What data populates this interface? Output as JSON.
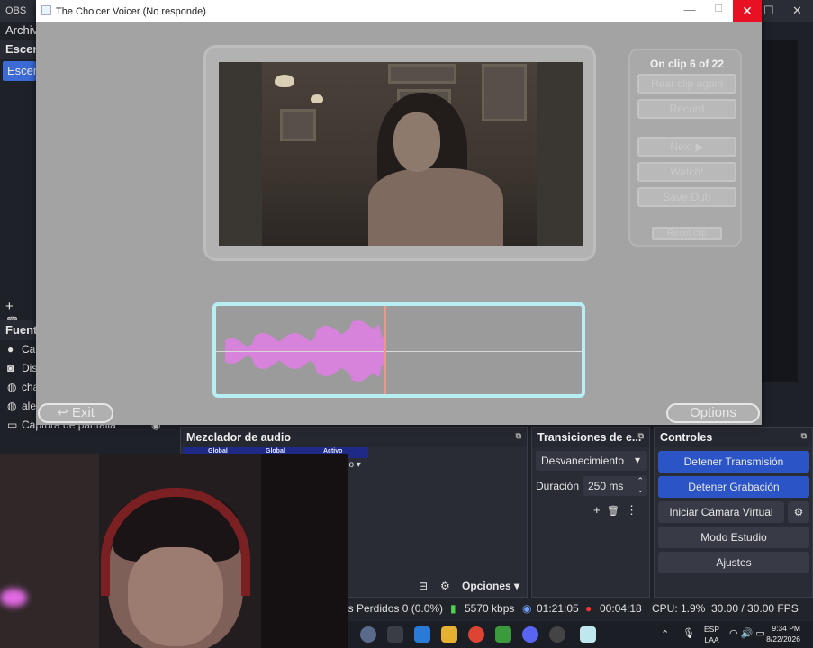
{
  "obs": {
    "title": "OBS",
    "menu": "Archiv",
    "scenes_header": "Escena",
    "scene_item": "Escen",
    "sources_header": "Fuent",
    "sources": [
      "Cap",
      "Dis",
      "cha",
      "ale",
      "Captura de pantalla"
    ],
    "mixer_title": "Mezclador de audio",
    "mixer_strip": [
      "Global",
      "Global",
      "Activo"
    ],
    "mixer_dropdown": "lio",
    "mixer_options": "Opciones",
    "transitions_title": "Transiciones de e...",
    "transition_value": "Desvanecimiento",
    "duration_label": "Duración",
    "duration_value": "250 ms",
    "controls_title": "Controles",
    "controls": {
      "stop_stream": "Detener Transmisión",
      "stop_record": "Detener Grabación",
      "virtual_cam": "Iniciar Cámara Virtual",
      "studio_mode": "Modo Estudio",
      "settings": "Ajustes"
    },
    "status": {
      "dropped": "as Perdidos 0 (0.0%)",
      "kbps": "5570 kbps",
      "stream_time": "01:21:05",
      "rec_time": "00:04:18",
      "cpu": "CPU: 1.9%",
      "fps": "30.00 / 30.00 FPS"
    }
  },
  "game": {
    "window_title": "The Choicer Voicer (No responde)",
    "clip_info": "On clip 6 of 22",
    "buttons": {
      "hear_again": "Hear clip again",
      "record": "Record",
      "next": "Next ▶",
      "watch": "Watch!",
      "save_dub": "Save Dub",
      "reset": "Reset clip"
    },
    "exit": "Exit",
    "options": "Options",
    "waveform_color": "#e27ee6",
    "playhead_fraction": 0.46
  },
  "taskbar": {
    "lang_top": "ESP",
    "lang_bottom": "LAA",
    "time": "9:34 PM",
    "date": "8/22/2026"
  }
}
